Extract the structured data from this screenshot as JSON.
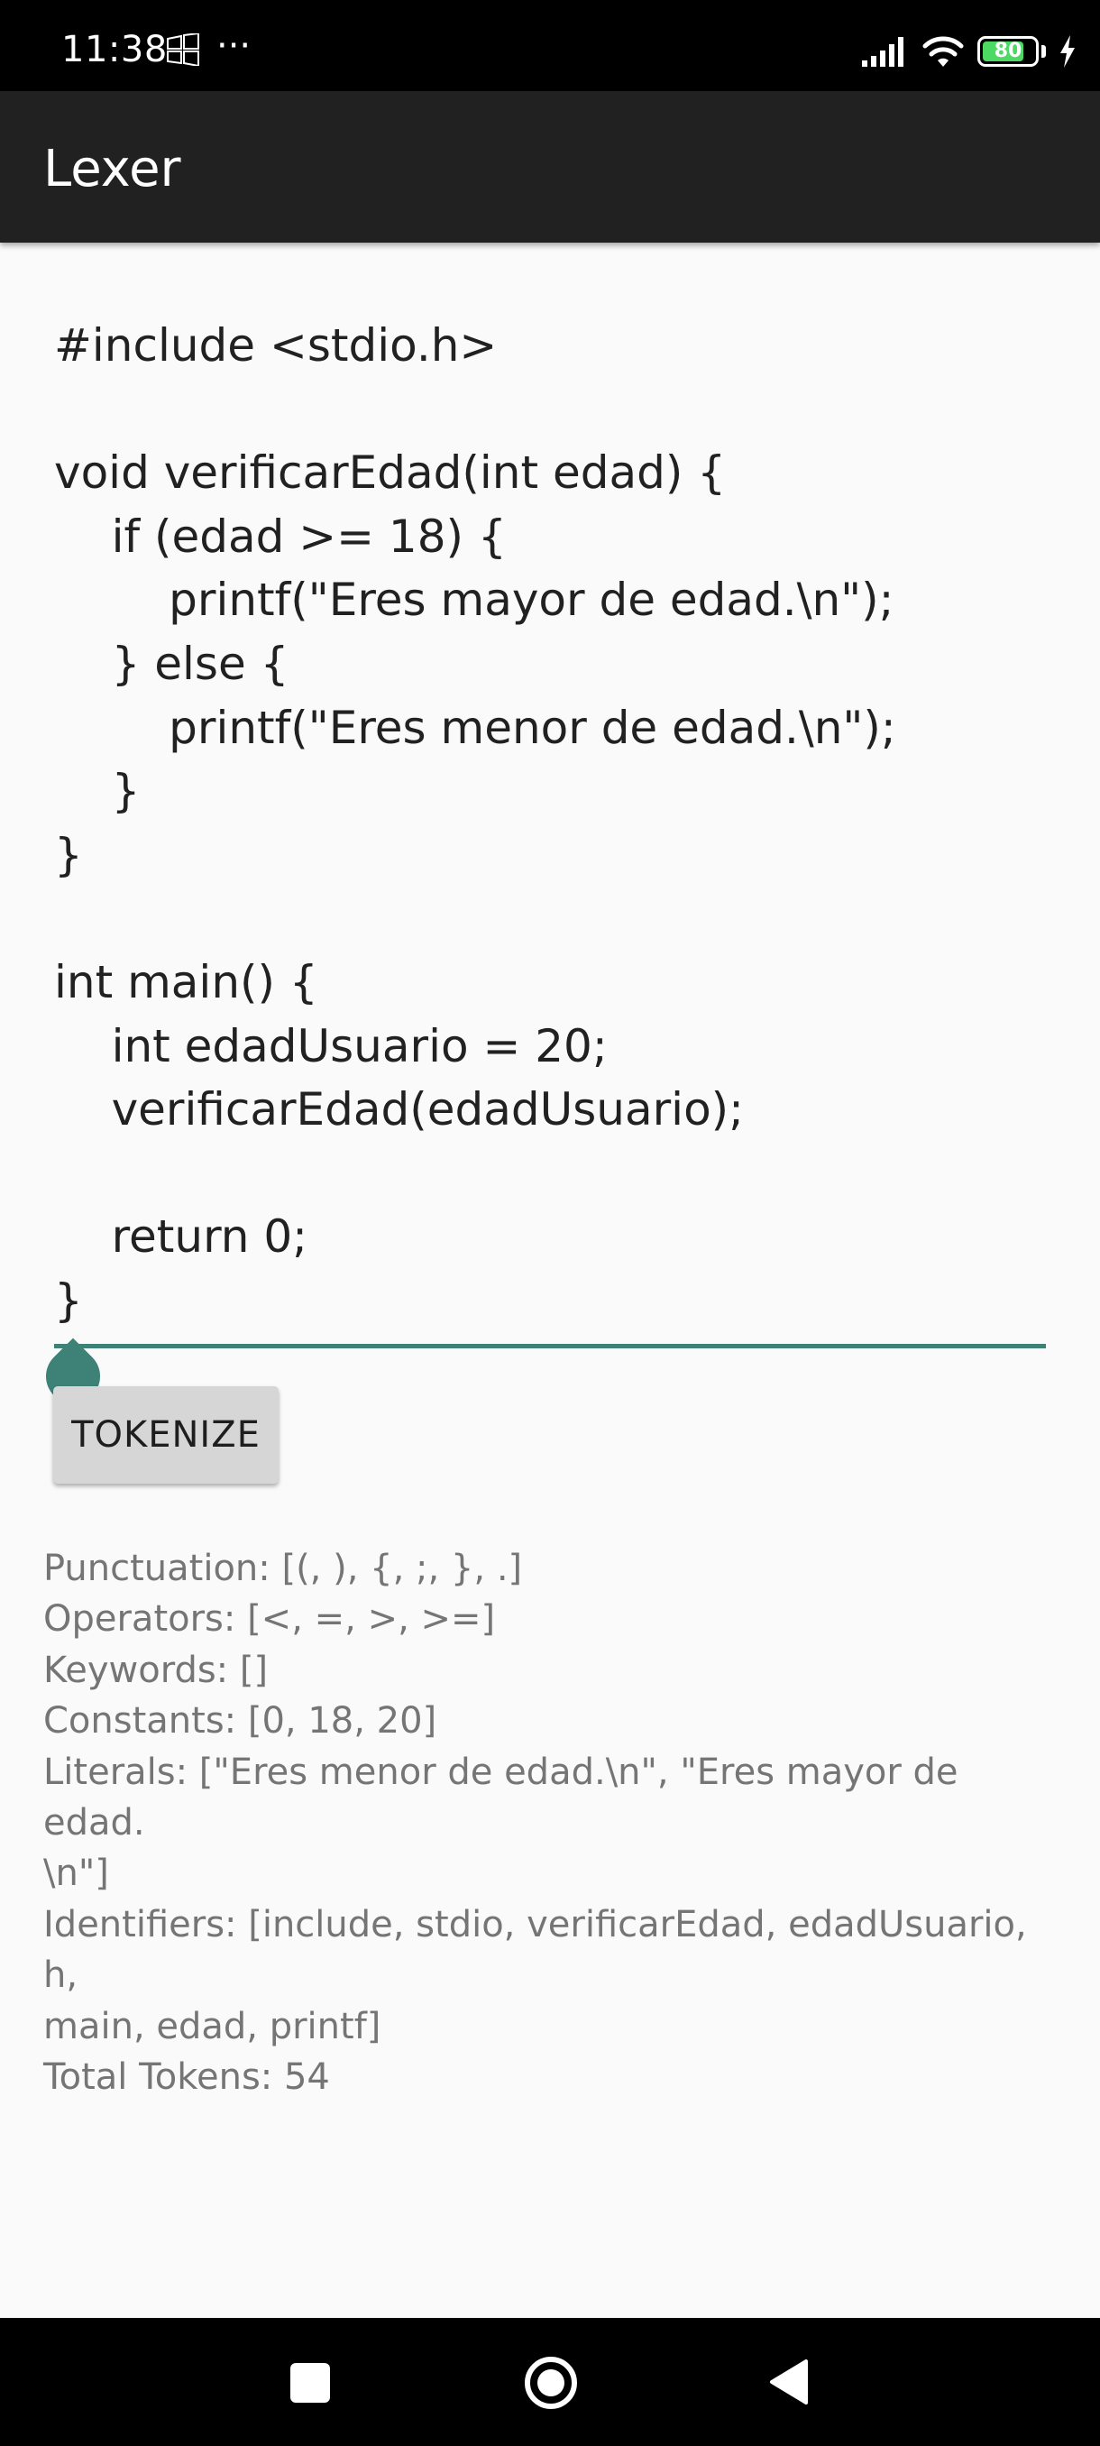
{
  "status_bar": {
    "time": "11:38",
    "more": "···",
    "battery_level": 80,
    "battery_label": "80"
  },
  "app_bar": {
    "title": "Lexer"
  },
  "editor": {
    "lines": [
      "#include <stdio.h>",
      "",
      "void verificarEdad(int edad) {",
      "    if (edad >= 18) {",
      "        printf(\"Eres mayor de edad.\\n\");",
      "    } else {",
      "        printf(\"Eres menor de edad.\\n\");",
      "    }",
      "}",
      "",
      "int main() {",
      "    int edadUsuario = 20;",
      "    verificarEdad(edadUsuario);",
      "",
      "    return 0;",
      "}"
    ]
  },
  "tokenize_button": {
    "label": "TOKENIZE"
  },
  "results": {
    "punctuation": "Punctuation: [(, ), {, ;, }, .]",
    "operators": "Operators: [<, =, >, >=]",
    "keywords": "Keywords: []",
    "constants": "Constants: [0, 18, 20]",
    "literals_line1": "Literals: [\"Eres menor de edad.\\n\", \"Eres mayor de edad.",
    "literals_line2": "\\n\"]",
    "identifiers_line1": "Identifiers: [include, stdio, verificarEdad, edadUsuario, h,",
    "identifiers_line2": "main, edad, printf]",
    "total": "Total Tokens: 54"
  },
  "colors": {
    "accent": "#3e8177",
    "app_bar": "#212121",
    "background": "#fafafa",
    "result_text": "#757575"
  }
}
